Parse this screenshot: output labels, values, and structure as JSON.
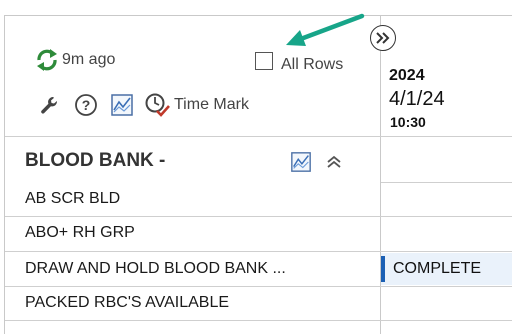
{
  "header": {
    "refresh_text": "9m ago",
    "all_rows_label": "All Rows",
    "all_rows_checked": false,
    "time_mark_label": "Time Mark",
    "icons": [
      "refresh-icon",
      "wrench-icon",
      "help-icon",
      "chart-icon",
      "time-mark-icon",
      "expand-icon"
    ]
  },
  "column": {
    "year": "2024",
    "date": "4/1/24",
    "time": "10:30"
  },
  "section": {
    "title": "BLOOD BANK -",
    "rows": [
      {
        "label": "AB SCR BLD",
        "value": ""
      },
      {
        "label": "ABO+ RH GRP",
        "value": ""
      },
      {
        "label": "DRAW AND HOLD BLOOD BANK ...",
        "value": "COMPLETE"
      },
      {
        "label": "PACKED RBC'S AVAILABLE",
        "value": ""
      }
    ]
  },
  "colors": {
    "accent_arrow": "#17a589",
    "refresh_green": "#2e8b3a",
    "status_bar": "#1a5fb4",
    "status_bg": "#eaf2fb"
  }
}
